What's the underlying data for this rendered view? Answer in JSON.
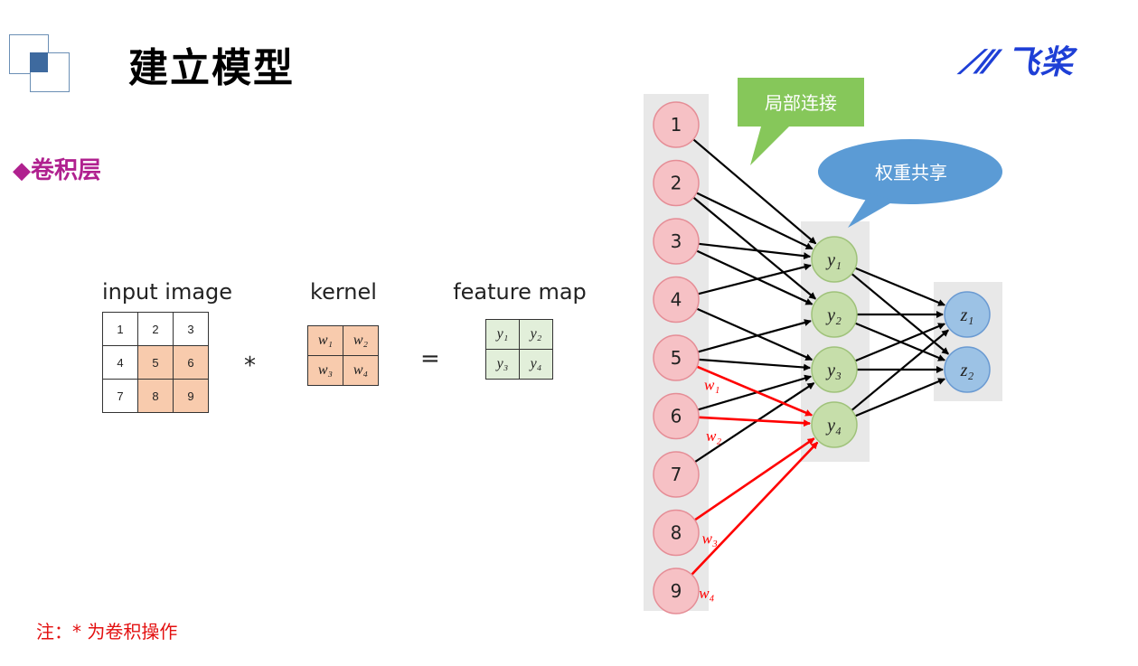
{
  "header": {
    "title": "建立模型",
    "brand": "飞桨"
  },
  "section": {
    "title": "◆卷积层"
  },
  "conv_example": {
    "input_label": "input image",
    "input_cells": [
      [
        "1",
        "2",
        "3"
      ],
      [
        "4",
        "5",
        "6"
      ],
      [
        "7",
        "8",
        "9"
      ]
    ],
    "highlighted_cells": [
      "5",
      "6",
      "8",
      "9"
    ],
    "operator": "*",
    "kernel_label": "kernel",
    "kernel_cells": [
      [
        "w₁",
        "w₂"
      ],
      [
        "w₃",
        "w₄"
      ]
    ],
    "equals": "=",
    "feature_label": "feature map",
    "feature_cells": [
      [
        "y₁",
        "y₂"
      ],
      [
        "y₃",
        "y₄"
      ]
    ]
  },
  "note": "注：* 为卷积操作",
  "network": {
    "callout_local": "局部连接",
    "callout_shared": "权重共享",
    "input_nodes": [
      "1",
      "2",
      "3",
      "4",
      "5",
      "6",
      "7",
      "8",
      "9"
    ],
    "hidden_nodes": [
      "y₁",
      "y₂",
      "y₃",
      "y₄"
    ],
    "output_nodes": [
      "z₁",
      "z₂"
    ],
    "edge_labels": [
      "w₁",
      "w₂",
      "w₃",
      "w₄"
    ],
    "input_to_hidden": [
      [
        1,
        1
      ],
      [
        2,
        1
      ],
      [
        2,
        2
      ],
      [
        3,
        1
      ],
      [
        3,
        2
      ],
      [
        4,
        1
      ],
      [
        4,
        3
      ],
      [
        5,
        2
      ],
      [
        5,
        3
      ],
      [
        5,
        4
      ],
      [
        6,
        3
      ],
      [
        6,
        4
      ],
      [
        7,
        3
      ],
      [
        8,
        4
      ],
      [
        9,
        4
      ]
    ],
    "highlighted_edges": [
      [
        5,
        4
      ],
      [
        6,
        4
      ],
      [
        8,
        4
      ],
      [
        9,
        4
      ]
    ],
    "hidden_to_output": [
      [
        1,
        1
      ],
      [
        1,
        2
      ],
      [
        2,
        1
      ],
      [
        2,
        2
      ],
      [
        3,
        1
      ],
      [
        3,
        2
      ],
      [
        4,
        1
      ],
      [
        4,
        2
      ]
    ],
    "colors": {
      "input_fill": "#f6c1c5",
      "input_stroke": "#e58d96",
      "hidden_fill": "#c6deaa",
      "hidden_stroke": "#9fc27a",
      "output_fill": "#9cc2e5",
      "output_stroke": "#6a9ad2",
      "edge": "#000000",
      "highlight_edge": "#ff0000",
      "panel": "#e8e8e8",
      "callout_local": "#86c75a",
      "callout_shared": "#5b9bd5"
    }
  }
}
